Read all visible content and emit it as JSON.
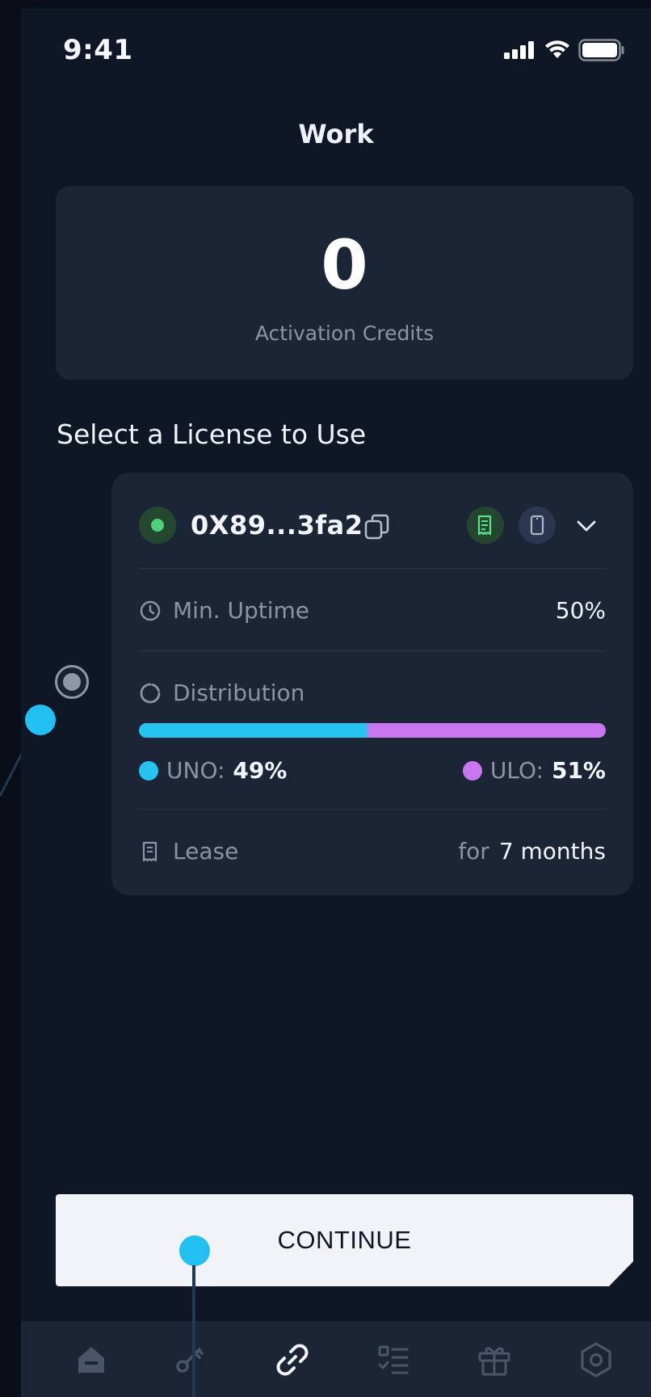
{
  "status_bar": {
    "time": "9:41"
  },
  "header": {
    "title": "Work"
  },
  "credits": {
    "value": "0",
    "label": "Activation Credits"
  },
  "section": {
    "title": "Select a License to Use"
  },
  "license": {
    "address": "0X89...3fa2",
    "min_uptime": {
      "label": "Min. Uptime",
      "value": "50%"
    },
    "distribution": {
      "label": "Distribution",
      "uno": {
        "name": "UNO:",
        "value": "49%",
        "fraction": 0.49,
        "color": "#26c2f0"
      },
      "ulo": {
        "name": "ULO:",
        "value": "51%",
        "fraction": 0.51,
        "color": "#c877f0"
      }
    },
    "lease": {
      "label": "Lease",
      "prefix": "for",
      "value": "7 months"
    }
  },
  "continue_label": "CONTINUE",
  "nav": {
    "items": [
      {
        "icon": "home-icon"
      },
      {
        "icon": "key-icon"
      },
      {
        "icon": "link-icon",
        "active": true
      },
      {
        "icon": "tasks-icon"
      },
      {
        "icon": "gift-icon"
      },
      {
        "icon": "settings-icon"
      }
    ]
  },
  "colors": {
    "accent": "#26c2f0",
    "secondary": "#c877f0",
    "online": "#4ed17a",
    "background": "#0f1626",
    "card": "#1c2536"
  }
}
